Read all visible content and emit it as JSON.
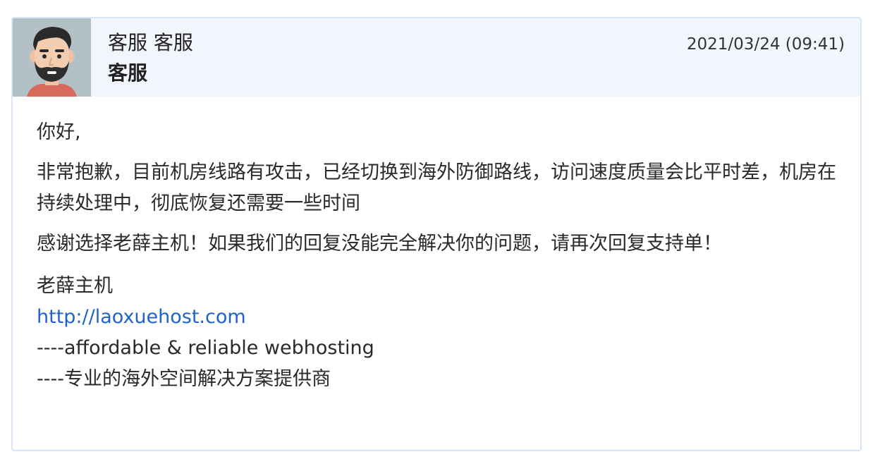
{
  "reply": {
    "author_name": "客服 客服",
    "author_role": "客服",
    "date": "2021/03/24 (09:41)",
    "avatar_icon": "bearded-man-avatar-icon",
    "greeting": "你好,",
    "message": "非常抱歉，目前机房线路有攻击，已经切换到海外防御路线，访问速度质量会比平时差，机房在持续处理中，彻底恢复还需要一些时间",
    "thanks": "感谢选择老薛主机！如果我们的回复没能完全解决你的问题，请再次回复支持单！",
    "signature": {
      "company": "老薛主机",
      "url": "http://laoxuehost.com",
      "tagline_en": "----affordable & reliable webhosting",
      "tagline_cn": "----专业的海外空间解决方案提供商"
    }
  },
  "colors": {
    "header_bg": "#f2f6fc",
    "border": "#d8e6f7",
    "link": "#1f63c6",
    "avatar_bg": "#b3c1c6"
  }
}
